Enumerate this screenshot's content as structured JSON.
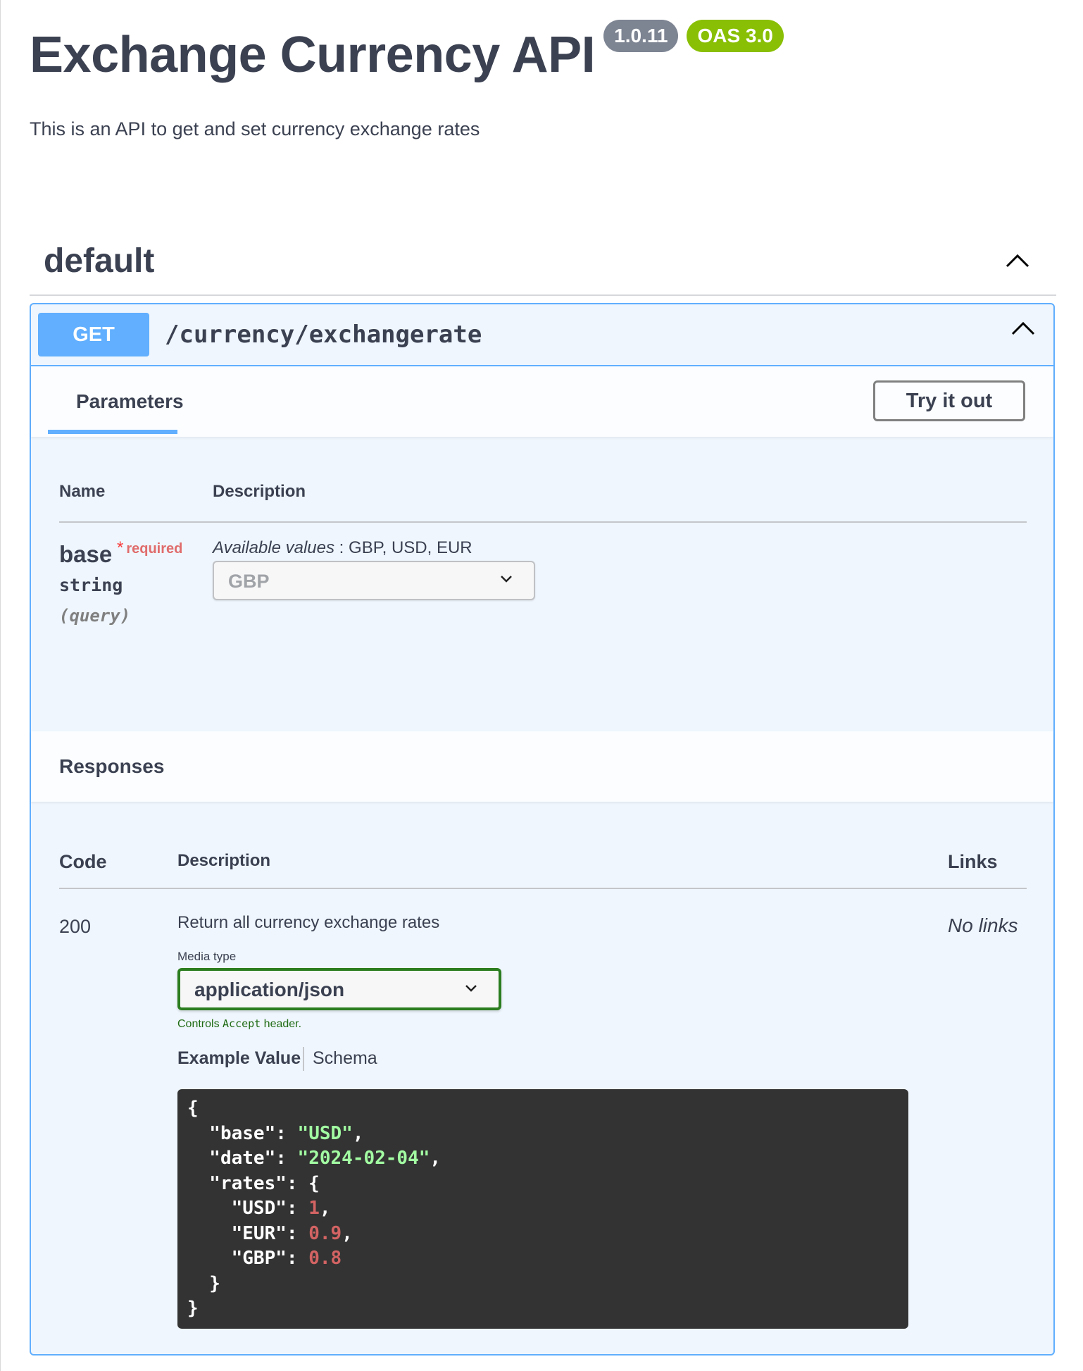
{
  "info": {
    "title": "Exchange Currency API",
    "version": "1.0.11",
    "oas": "OAS 3.0",
    "description": "This is an API to get and set currency exchange rates"
  },
  "section": {
    "title": "default"
  },
  "operation": {
    "method": "GET",
    "path": "/currency/exchangerate",
    "parameters_tab": "Parameters",
    "try_it_out": "Try it out",
    "param_headers": {
      "name": "Name",
      "description": "Description"
    },
    "param": {
      "name": "base",
      "required_star": "*",
      "required": "required",
      "type": "string",
      "in": "(query)",
      "available_label": "Available values",
      "available_values": " : GBP, USD, EUR",
      "selected": "GBP",
      "options": [
        "GBP",
        "USD",
        "EUR"
      ]
    },
    "responses_title": "Responses",
    "response_headers": {
      "code": "Code",
      "description": "Description",
      "links": "Links"
    },
    "response": {
      "code": "200",
      "description": "Return all currency exchange rates",
      "links": "No links",
      "media_type_label": "Media type",
      "media_type": "application/json",
      "controls_prefix": "Controls ",
      "controls_code": "Accept",
      "controls_suffix": " header.",
      "example_tab": "Example Value",
      "schema_tab": "Schema",
      "example": {
        "base": "USD",
        "date": "2024-02-04",
        "rates": {
          "USD": 1,
          "EUR": 0.9,
          "GBP": 0.8
        }
      }
    }
  },
  "colors": {
    "get_method": "#61affe",
    "version_badge": "#7d8492",
    "oas_badge": "#89bf04",
    "required": "#f93e3e",
    "media_select_border": "#2b7d1f",
    "code_bg": "#333333"
  }
}
